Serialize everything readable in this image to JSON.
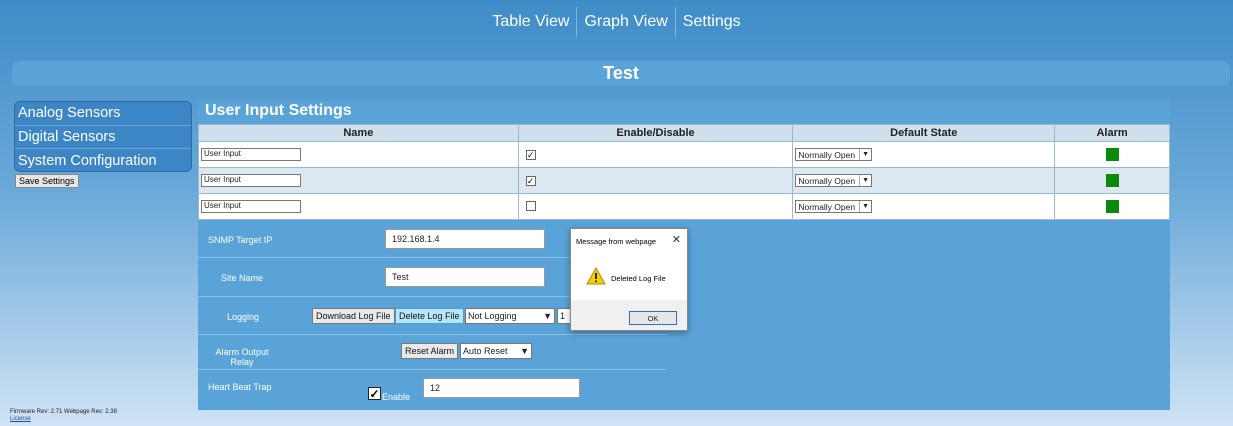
{
  "nav": {
    "table_view": "Table View",
    "graph_view": "Graph View",
    "settings": "Settings"
  },
  "page_title": "Test",
  "sidebar": {
    "items": [
      {
        "label": "Analog Sensors"
      },
      {
        "label": "Digital Sensors"
      },
      {
        "label": "System Configuration"
      }
    ]
  },
  "save_settings": "Save Settings",
  "footer": {
    "firmware": "Firmware Rev: 2.71 Webpage Rev: 2.38",
    "license": "License"
  },
  "user_input": {
    "title": "User Input Settings",
    "columns": [
      "Name",
      "Enable/Disable",
      "Default State",
      "Alarm"
    ],
    "rows": [
      {
        "name": "User Input",
        "enabled": "✓",
        "state": "Normally Open"
      },
      {
        "name": "User Input",
        "enabled": "✓",
        "state": "Normally Open"
      },
      {
        "name": "User Input",
        "enabled": "",
        "state": "Normally Open"
      }
    ],
    "alarm_color": "#0a8a0a"
  },
  "config": {
    "snmp_label": "SNMP Target IP",
    "snmp_value": "192.168.1.4",
    "site_label": "Site Name",
    "site_value": "Test",
    "logging_label": "Logging",
    "download_btn": "Download Log File",
    "delete_btn": "Delete Log File",
    "logging_select": "Not Logging",
    "logging_extra": "1",
    "alarm_label": "Alarm Output Relay",
    "reset_btn": "Reset Alarm",
    "reset_select": "Auto Reset",
    "heartbeat_label": "Heart Beat Trap",
    "enable_label": "Enable",
    "enable_checked": "✓",
    "heartbeat_value": "12"
  },
  "dialog": {
    "title": "Message from webpage",
    "close": "✕",
    "message": "Deleted Log File",
    "ok": "OK"
  }
}
